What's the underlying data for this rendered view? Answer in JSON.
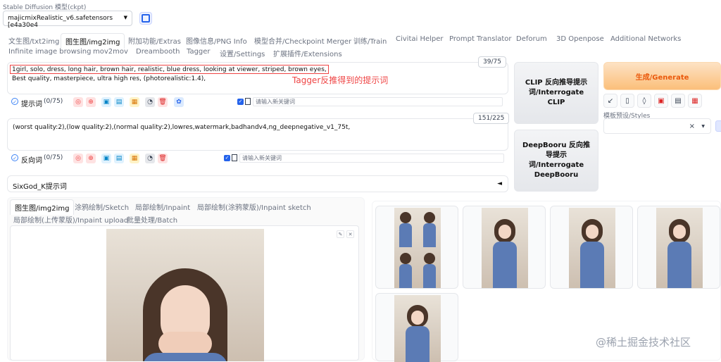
{
  "model": {
    "label": "Stable Diffusion 模型(ckpt)",
    "value": "majicmixRealistic_v6.safetensors [e4a30e4"
  },
  "tabs_row1": [
    "文生图/txt2img",
    "图生图/img2img",
    "附加功能/Extras",
    "图像信息/PNG Info",
    "模型合并/Checkpoint Merger",
    "训练/Train",
    "Civitai Helper",
    "Prompt Translator",
    "Deforum",
    "3D Openpose",
    "Additional Networks"
  ],
  "tabs_row2": [
    "Infinite image browsing",
    "mov2mov",
    "Dreambooth",
    "Tagger",
    "设置/Settings",
    "扩展插件/Extensions"
  ],
  "prompt": {
    "counter": "39/75",
    "line1": "1girl, solo, dress, long hair, brown hair, realistic, blue dress, looking at viewer, striped, brown eyes,",
    "line2": "Best quality, masterpiece, ultra high res, (photorealistic:1.4),",
    "annotation": "Tagger反推得到的提示词",
    "toolbar_label": "提示词",
    "toolbar_count": "(0/75)",
    "keyword_placeholder": "请输入新关键词"
  },
  "negative": {
    "counter": "151/225",
    "text": "(worst quality:2),(low quality:2),(normal quality:2),lowres,watermark,badhandv4,ng_deepnegative_v1_75t,",
    "toolbar_label": "反向词",
    "toolbar_count": "(0/75)",
    "keyword_placeholder": "请输入新关键词"
  },
  "buttons": {
    "clip": "CLIP 反向推导提示词/Interrogate CLIP",
    "deepbooru": "DeepBooru 反向推导提示词/Interrogate DeepBooru",
    "generate": "生成/Generate",
    "styles_label": "模板预设/Styles",
    "styles_clear": "×"
  },
  "sixgod": {
    "label": "SixGod_K提示词",
    "arrow": "◄"
  },
  "img_tabs_row1": [
    "图生图/img2img",
    "涂鸦绘制/Sketch",
    "局部绘制/Inpaint",
    "局部绘制(涂鸦蒙版)/Inpaint sketch"
  ],
  "img_tabs_row2": [
    "局部绘制(上传蒙版)/Inpaint upload",
    "批量处理/Batch"
  ],
  "watermark": "@稀土掘金技术社区",
  "colors": {
    "accent_orange": "#ea580c",
    "annotation_red": "#ef4444",
    "dress_blue": "#5b7bb5"
  }
}
